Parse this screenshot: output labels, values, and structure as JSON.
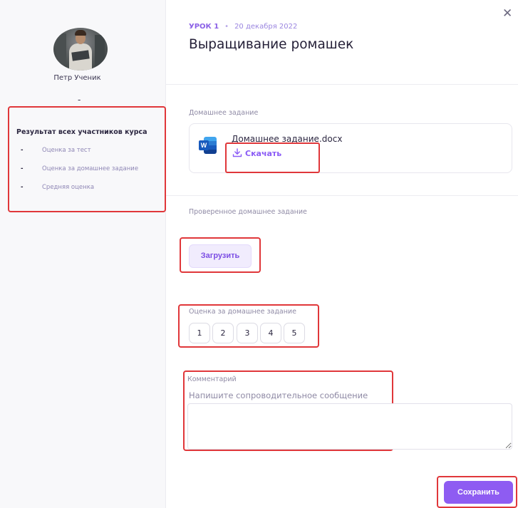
{
  "user": {
    "name": "Петр Ученик",
    "separator": "-"
  },
  "results": {
    "title": "Результат всех участников курса",
    "items": [
      {
        "dash": "-",
        "label": "Оценка за тест"
      },
      {
        "dash": "-",
        "label": "Оценка за домашнее задание"
      },
      {
        "dash": "-",
        "label": "Средняя оценка"
      }
    ]
  },
  "lesson": {
    "number_label": "УРОК 1",
    "dot": "•",
    "date": "20 декабря 2022",
    "title": "Выращивание ромашек"
  },
  "close": {
    "symbol": "✕"
  },
  "homework": {
    "section_label": "Домашнее задание",
    "file_name": "Домашнее задание.docx",
    "file_icon_letter": "W",
    "download_label": "Скачать"
  },
  "checked": {
    "section_label": "Проверенное домашнее задание",
    "upload_label": "Загрузить"
  },
  "grade": {
    "label": "Оценка за домашнее задание",
    "options": [
      "1",
      "2",
      "3",
      "4",
      "5"
    ]
  },
  "comment": {
    "label": "Комментарий",
    "hint": "Напишите сопроводительное сообщение",
    "value": ""
  },
  "actions": {
    "save_label": "Сохранить"
  },
  "colors": {
    "accent": "#8e5cf2",
    "highlight": "#e0373a",
    "link": "#8b5cf6"
  }
}
